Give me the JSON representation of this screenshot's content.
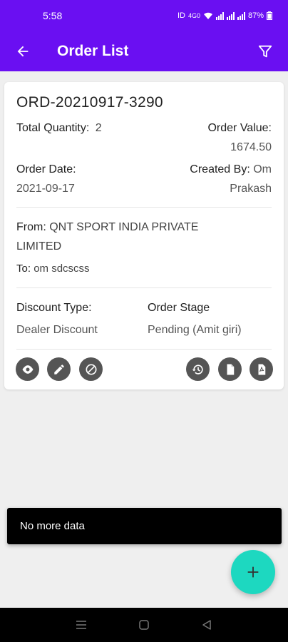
{
  "status_bar": {
    "time": "5:58",
    "net": "ID",
    "speed": "4G0",
    "battery": "87%"
  },
  "app_bar": {
    "title": "Order List",
    "back_icon": "arrow-left-icon",
    "filter_icon": "filter-icon"
  },
  "order": {
    "id": "ORD-20210917-3290",
    "total_quantity_label": "Total Quantity:",
    "total_quantity_value": "2",
    "order_value_label": "Order Value:",
    "order_value": "1674.50",
    "order_date_label": "Order Date:",
    "order_date": "2021-09-17",
    "created_by_label": "Created By:",
    "created_by_first": "Om",
    "created_by_rest": "Prakash",
    "from_label": "From:",
    "from_line1": "QNT SPORT INDIA PRIVATE",
    "from_line2": "LIMITED",
    "to_label": "To:",
    "to_value": "om sdcscss",
    "discount_type_label": "Discount Type:",
    "discount_type": "Dealer Discount",
    "order_stage_label": "Order Stage",
    "order_stage": "Pending (Amit giri)",
    "actions": [
      "view-icon",
      "edit-icon",
      "cancel-icon",
      "history-icon",
      "document-icon",
      "pdf-icon"
    ]
  },
  "toast": {
    "message": "No more data"
  },
  "fab": {
    "icon": "plus-icon",
    "color": "#1dd8c0"
  },
  "theme": {
    "primary": "#6a0ff2",
    "icon_button": "#555555"
  },
  "nav_bar": {
    "icons": [
      "recents-icon",
      "home-icon",
      "back-icon"
    ]
  }
}
